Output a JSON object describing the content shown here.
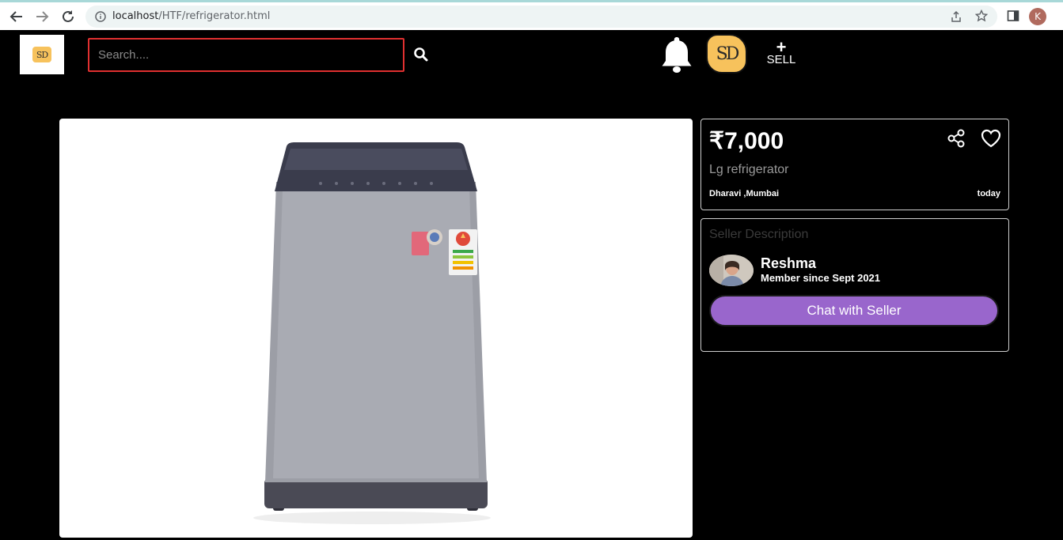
{
  "browser": {
    "url_host": "localhost",
    "url_path": "/HTF/refrigerator.html",
    "profile_initial": "K"
  },
  "header": {
    "logo_text": "SD",
    "search_placeholder": "Search....",
    "avatar_text": "SD",
    "sell_plus": "+",
    "sell_label": "SELL"
  },
  "listing": {
    "price": "₹7,000",
    "title": "Lg refrigerator",
    "location": "Dharavi ,Mumbai",
    "posted": "today"
  },
  "seller": {
    "heading": "Seller Description",
    "name": "Reshma",
    "member_since": "Member since Sept 2021",
    "chat_label": "Chat with Seller"
  },
  "icons": {
    "back": "back-arrow-icon",
    "forward": "forward-arrow-icon",
    "reload": "reload-icon",
    "info": "info-icon",
    "share_page": "share-page-icon",
    "bookmark": "star-icon",
    "sidebar": "sidebar-icon",
    "search": "search-icon",
    "bell": "bell-icon",
    "share": "share-icon",
    "favorite": "heart-icon"
  },
  "colors": {
    "accent": "#9966cc",
    "search_border": "#e03030",
    "logo_yellow": "#f7c25c"
  }
}
